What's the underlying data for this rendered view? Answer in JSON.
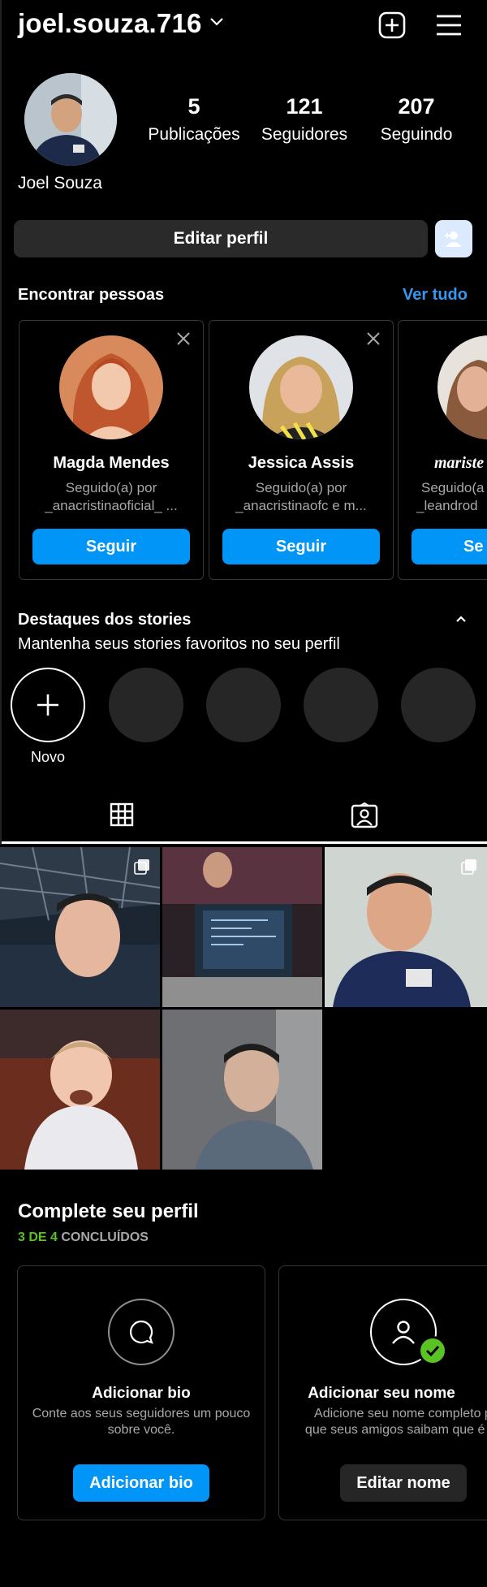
{
  "header": {
    "username": "joel.souza.716",
    "icons": [
      "chevron-down-icon",
      "new-post-icon",
      "menu-icon"
    ]
  },
  "profile": {
    "full_name": "Joel Souza",
    "stats": [
      {
        "value": "5",
        "label": "Publicações"
      },
      {
        "value": "121",
        "label": "Seguidores"
      },
      {
        "value": "207",
        "label": "Seguindo"
      }
    ]
  },
  "actions": {
    "edit_profile": "Editar perfil",
    "add_user_icon": "add-person-icon"
  },
  "suggestions": {
    "title": "Encontrar pessoas",
    "see_all": "Ver tudo",
    "items": [
      {
        "name": "Magda Mendes",
        "line1": "Seguido(a) por",
        "line2": "_anacristinaoficial_ ...",
        "button": "Seguir"
      },
      {
        "name": "Jessica Assis",
        "line1": "Seguido(a) por",
        "line2": "_anacristinaofc e m...",
        "button": "Seguir"
      },
      {
        "name": "mariste",
        "line1": "Seguido(a",
        "line2": "_leandrod",
        "button": "Se"
      }
    ]
  },
  "highlights": {
    "title": "Destaques dos stories",
    "subtitle": "Mantenha seus stories favoritos no seu perfil",
    "new_label": "Novo"
  },
  "tabs": [
    "grid-icon",
    "tagged-icon"
  ],
  "complete_profile": {
    "title": "Complete seu perfil",
    "progress_done": "3 DE 4",
    "progress_label": "CONCLUÍDOS",
    "cards": [
      {
        "title": "Adicionar bio",
        "desc": "Conte aos seus seguidores um pouco sobre você.",
        "button": "Adicionar bio"
      },
      {
        "title": "Adicionar seu nome",
        "desc": "Adicione seu nome completo para que seus amigos saibam que é você.",
        "button": "Editar nome"
      }
    ]
  },
  "colors": {
    "accent": "#0095f6",
    "link": "#3797f0",
    "success": "#58c322",
    "card_bg": "#2a2a2a"
  }
}
